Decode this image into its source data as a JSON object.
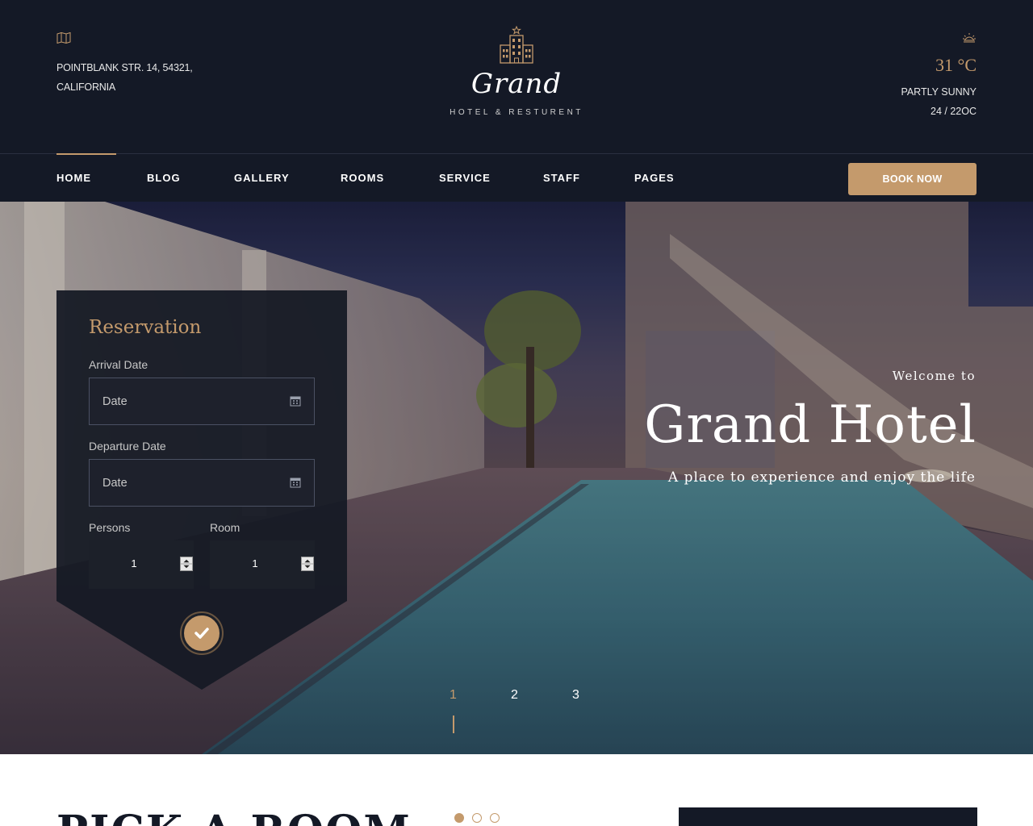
{
  "header": {
    "address_line1": "POINTBLANK STR. 14, 54321,",
    "address_line2": "CALIFORNIA",
    "logo_name": "Grand",
    "logo_sub": "HOTEL & RESTURENT",
    "weather": {
      "temperature": "31 °C",
      "condition": "PARTLY SUNNY",
      "range": "24 / 22OC"
    }
  },
  "nav": {
    "items": [
      {
        "label": "HOME",
        "active": true
      },
      {
        "label": "BLOG"
      },
      {
        "label": "GALLERY"
      },
      {
        "label": "ROOMS"
      },
      {
        "label": "SERVICE"
      },
      {
        "label": "STAFF"
      },
      {
        "label": "PAGES"
      }
    ],
    "book_label": "BOOK NOW"
  },
  "hero": {
    "welcome": "Welcome to",
    "title": "Grand Hotel",
    "tagline": "A place to experience and enjoy the life",
    "slides": [
      "1",
      "2",
      "3"
    ],
    "active_slide": "1"
  },
  "reservation": {
    "title": "Reservation",
    "arrival_label": "Arrival Date",
    "arrival_placeholder": "Date",
    "departure_label": "Departure Date",
    "departure_placeholder": "Date",
    "persons_label": "Persons",
    "persons_value": "1",
    "room_label": "Room",
    "room_value": "1"
  },
  "section": {
    "title": "PICK A ROOM"
  },
  "colors": {
    "accent": "#c49a6c",
    "dark": "#141926"
  }
}
